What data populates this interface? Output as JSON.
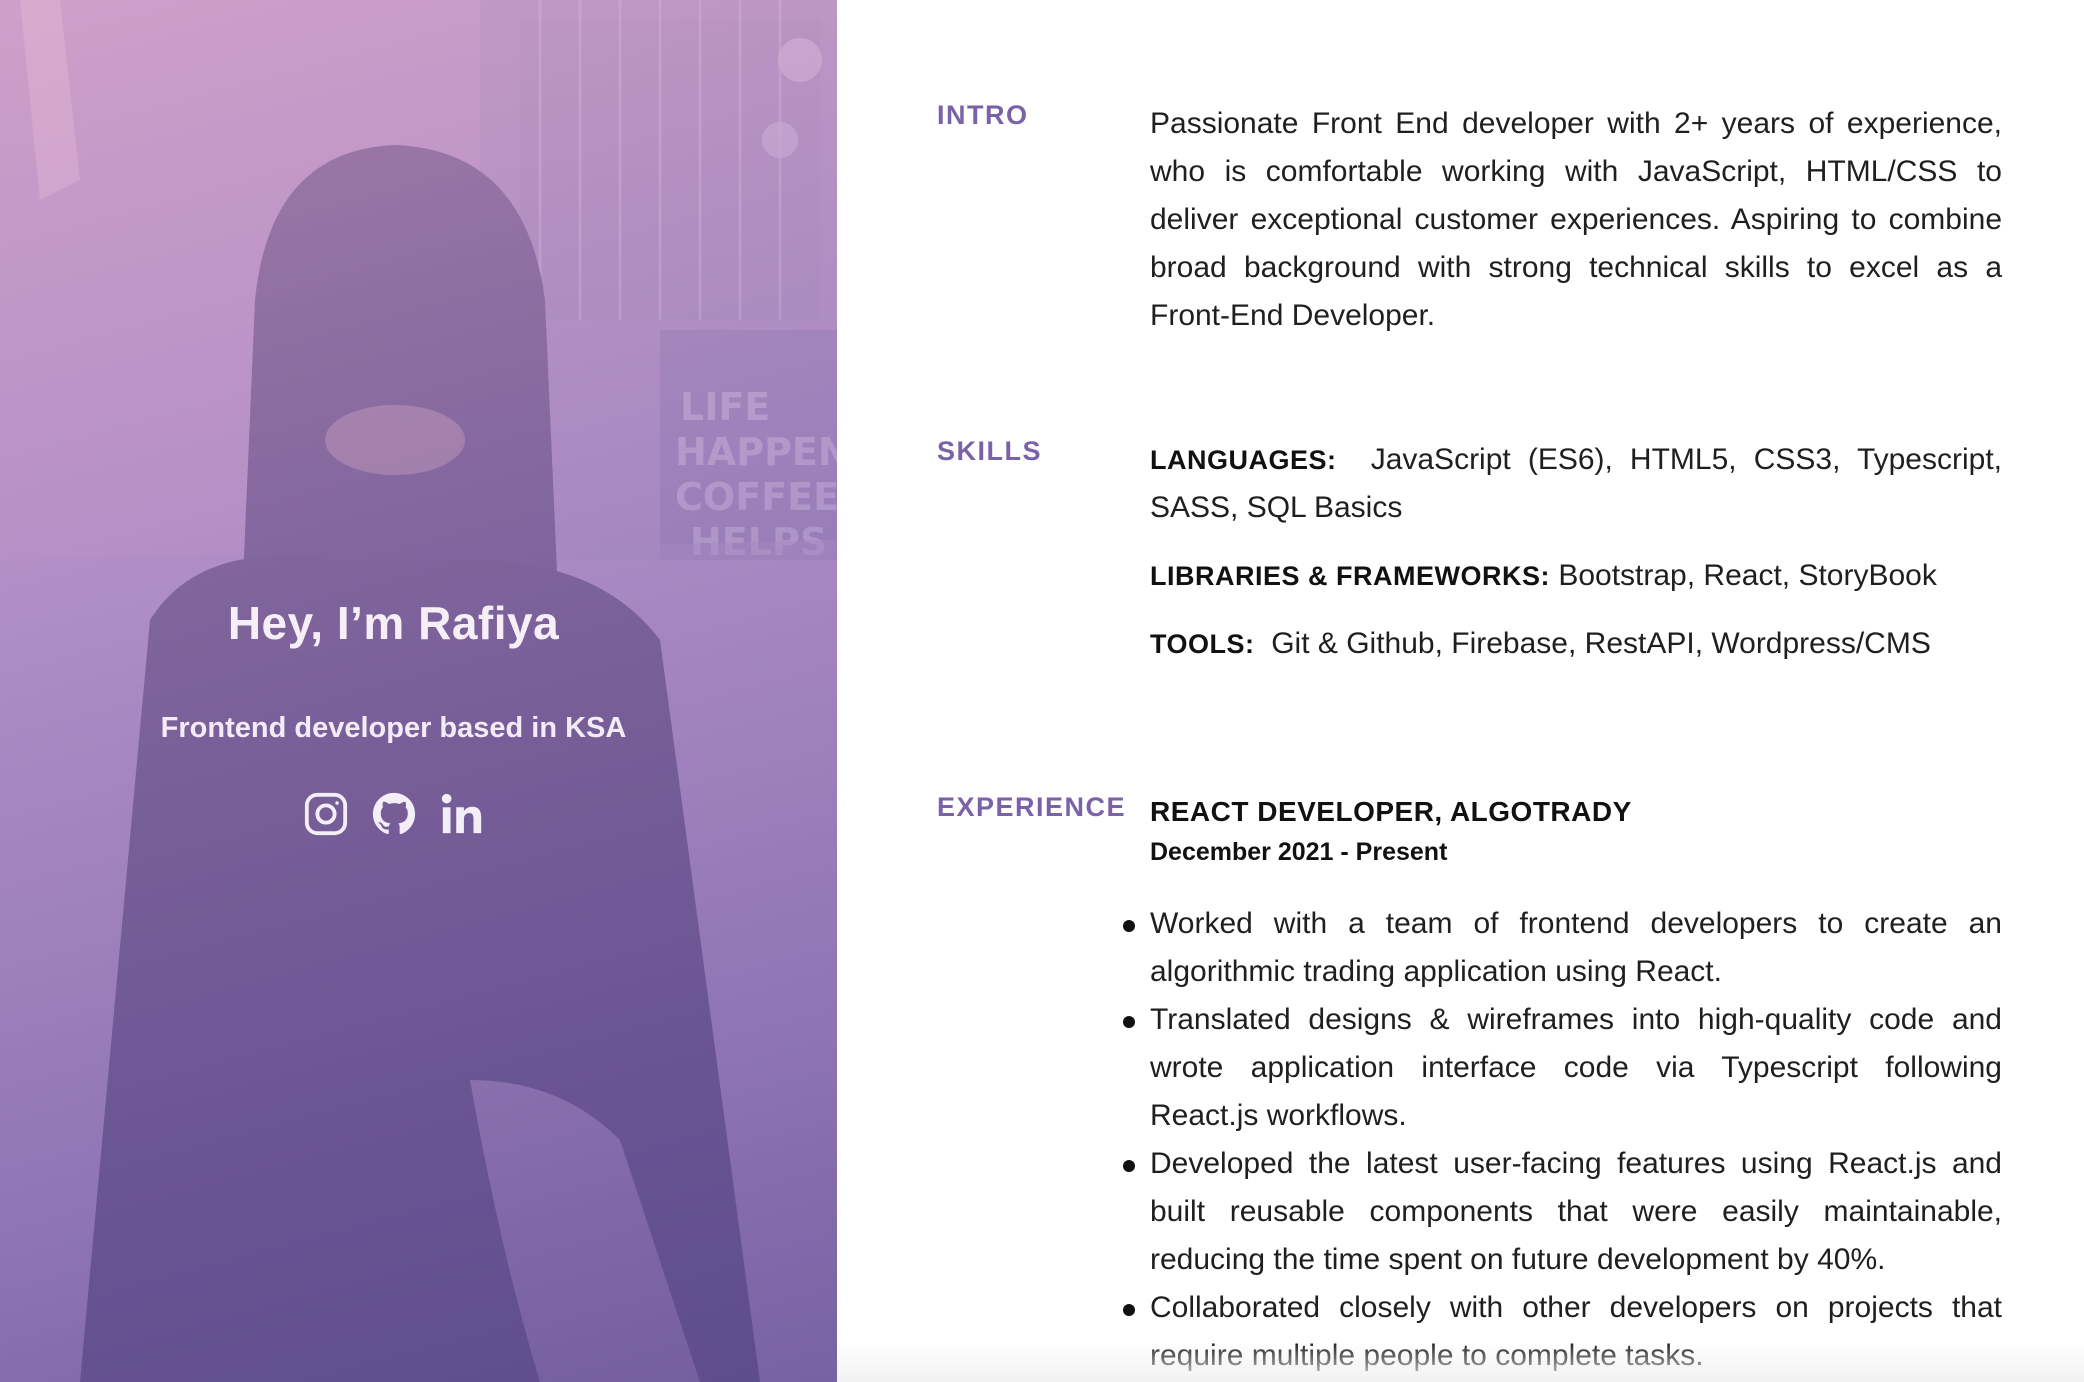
{
  "hero": {
    "title": "Hey, I’m Rafiya",
    "subtitle": "Frontend developer based in KSA",
    "social": [
      {
        "icon": "instagram-icon"
      },
      {
        "icon": "github-icon"
      },
      {
        "icon": "linkedin-icon"
      }
    ],
    "colors": {
      "accent": "#7a62a8",
      "gradient_top": "#d8a6c8",
      "gradient_bottom": "#6b5499"
    }
  },
  "intro": {
    "label": "INTRO",
    "text": "Passionate Front End developer with 2+ years of experience, who is comfortable working with JavaScript, HTML/CSS to deliver exceptional customer experiences. Aspiring to combine broad background with strong technical skills to excel as a Front-End Developer."
  },
  "skills": {
    "label": "SKILLS",
    "items": [
      {
        "key": "LANGUAGES:",
        "value": "JavaScript (ES6), HTML5, CSS3, Typescript, SASS, SQL Basics"
      },
      {
        "key": "LIBRARIES & FRAMEWORKS:",
        "value": "Bootstrap, React, StoryBook"
      },
      {
        "key": "TOOLS:",
        "value": "Git & Github, Firebase, RestAPI, Wordpress/CMS"
      }
    ]
  },
  "experience": {
    "label": "EXPERIENCE",
    "jobs": [
      {
        "title": "REACT DEVELOPER, ALGOTRADY",
        "dates": "December 2021 - Present",
        "bullets": [
          "Worked with a team of frontend developers to create an algorithmic trading application using React.",
          "Translated designs & wireframes into high-quality code and wrote application interface code via Typescript following React.js workflows.",
          "Developed the latest user-facing features using React.js and built reusable components that were easily maintainable, reducing the time spent on future development by 40%.",
          "Collaborated closely with other developers on projects that require multiple people to complete tasks."
        ]
      }
    ]
  }
}
